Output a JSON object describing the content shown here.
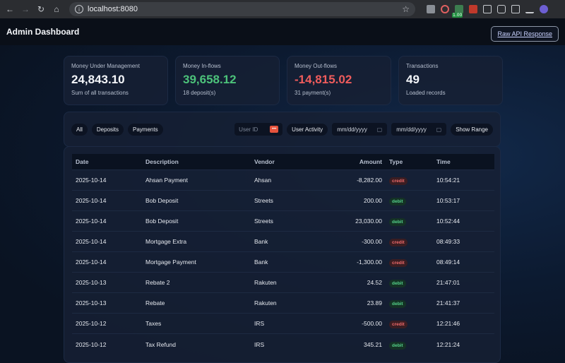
{
  "browser": {
    "url": "localhost:8080"
  },
  "header": {
    "title": "Admin Dashboard",
    "raw_api_label": "Raw API Response"
  },
  "cards": [
    {
      "label": "Money Under Management",
      "value": "24,843.10",
      "sub": "Sum of all transactions",
      "color": "#f4f6fa"
    },
    {
      "label": "Money In-flows",
      "value": "39,658.12",
      "sub": "18 deposit(s)",
      "color": "#4cc27a"
    },
    {
      "label": "Money Out-flows",
      "value": "-14,815.02",
      "sub": "31 payment(s)",
      "color": "#ef5c5c"
    },
    {
      "label": "Transactions",
      "value": "49",
      "sub": "Loaded records",
      "color": "#f4f6fa"
    }
  ],
  "filters": {
    "all_label": "All",
    "deposits_label": "Deposits",
    "payments_label": "Payments",
    "user_id_placeholder": "User ID",
    "user_activity_label": "User Activity",
    "date_from_placeholder": "mm/dd/yyyy",
    "date_to_placeholder": "mm/dd/yyyy",
    "show_range_label": "Show Range"
  },
  "table": {
    "columns": [
      "Date",
      "Description",
      "Vendor",
      "Amount",
      "Type",
      "Time"
    ],
    "rows": [
      {
        "date": "2025-10-14",
        "description": "Ahsan Payment",
        "vendor": "Ahsan",
        "amount": "-8,282.00",
        "type": "credit",
        "time": "10:54:21"
      },
      {
        "date": "2025-10-14",
        "description": "Bob Deposit",
        "vendor": "Streets",
        "amount": "200.00",
        "type": "debit",
        "time": "10:53:17"
      },
      {
        "date": "2025-10-14",
        "description": "Bob Deposit",
        "vendor": "Streets",
        "amount": "23,030.00",
        "type": "debit",
        "time": "10:52:44"
      },
      {
        "date": "2025-10-14",
        "description": "Mortgage Extra",
        "vendor": "Bank",
        "amount": "-300.00",
        "type": "credit",
        "time": "08:49:33"
      },
      {
        "date": "2025-10-14",
        "description": "Mortgage Payment",
        "vendor": "Bank",
        "amount": "-1,300.00",
        "type": "credit",
        "time": "08:49:14"
      },
      {
        "date": "2025-10-13",
        "description": "Rebate 2",
        "vendor": "Rakuten",
        "amount": "24.52",
        "type": "debit",
        "time": "21:47:01"
      },
      {
        "date": "2025-10-13",
        "description": "Rebate",
        "vendor": "Rakuten",
        "amount": "23.89",
        "type": "debit",
        "time": "21:41:37"
      },
      {
        "date": "2025-10-12",
        "description": "Taxes",
        "vendor": "IRS",
        "amount": "-500.00",
        "type": "credit",
        "time": "12:21:46"
      },
      {
        "date": "2025-10-12",
        "description": "Tax Refund",
        "vendor": "IRS",
        "amount": "345.21",
        "type": "debit",
        "time": "12:21:24"
      }
    ]
  }
}
